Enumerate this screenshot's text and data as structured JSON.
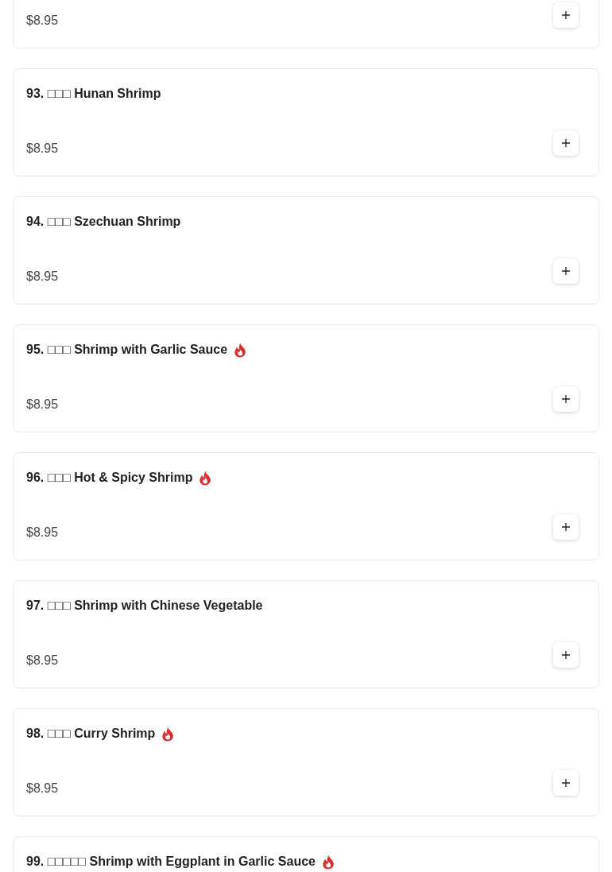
{
  "items": [
    {
      "price": "$8.95",
      "spicy": false
    },
    {
      "title": "93. □□□ Hunan Shrimp",
      "price": "$8.95",
      "spicy": false
    },
    {
      "title": "94. □□□ Szechuan Shrimp",
      "price": "$8.95",
      "spicy": false
    },
    {
      "title": "95. □□□ Shrimp with Garlic Sauce",
      "price": "$8.95",
      "spicy": true
    },
    {
      "title": "96. □□□ Hot & Spicy Shrimp",
      "price": "$8.95",
      "spicy": true
    },
    {
      "title": "97. □□□ Shrimp with Chinese Vegetable",
      "price": "$8.95",
      "spicy": false
    },
    {
      "title": "98. □□□ Curry Shrimp",
      "price": "$8.95",
      "spicy": true
    },
    {
      "title": "99. □□□□□ Shrimp with Eggplant in Garlic Sauce",
      "spicy": true
    }
  ]
}
